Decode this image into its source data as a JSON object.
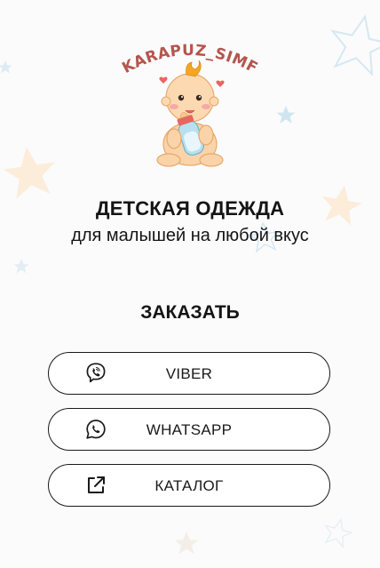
{
  "brand": {
    "logo_text": "KARAPUZ_SIMF"
  },
  "header": {
    "title": "ДЕТСКАЯ ОДЕЖДА",
    "subtitle": "для малышей на любой вкус"
  },
  "order": {
    "heading": "ЗАКАЗАТЬ"
  },
  "links": [
    {
      "label": "VIBER",
      "icon": "viber-icon"
    },
    {
      "label": "WHATSAPP",
      "icon": "whatsapp-icon"
    },
    {
      "label": "КАТАЛОГ",
      "icon": "external-link-icon"
    }
  ],
  "colors": {
    "background": "#fbfbfc",
    "text": "#141414",
    "button_border": "#1a1a1a",
    "logo_text": "#b5554d",
    "star_yellow": "#fbe3c3",
    "star_blue": "#cfe6f0"
  }
}
